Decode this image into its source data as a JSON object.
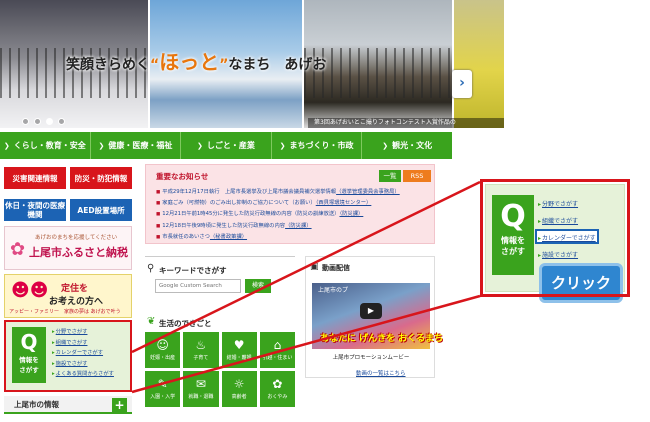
{
  "hero": {
    "slogan_pre": "笑顔きらめく",
    "slogan_q1": "“",
    "slogan_hotto": "ほっと",
    "slogan_q2": "”",
    "slogan_post": "なまち　あげお",
    "caption": "第3回あげおいとこ撮りフォトコンテスト入賞作品の",
    "next": "›",
    "dots": 4,
    "active_dot": 3
  },
  "nav": [
    {
      "label": "くらし・教育・安全",
      "icon": "chevron-icon"
    },
    {
      "label": "健康・医療・福祉",
      "icon": "chevron-icon"
    },
    {
      "label": "しごと・産業",
      "icon": "chevron-icon"
    },
    {
      "label": "まちづくり・市政",
      "icon": "chevron-icon"
    },
    {
      "label": "観光・文化",
      "icon": "chevron-icon"
    }
  ],
  "left": {
    "saigai": "災害関連情報",
    "bohan": "防災・防犯情報",
    "kyujitsu": "休日・夜間の医療機関",
    "aed": "AED設置場所",
    "furusato_t1": "あげおのまちを応援してください",
    "furusato_t2": "上尾市ふるさと納税",
    "teiju_t1": "定住を",
    "teiju_t2": "お考えの方へ",
    "teiju_t3": "アッピー・ファミリー　家族の夢は あげおで叶う",
    "search_label": "情報を\nさがす",
    "search_label_1": "情報を",
    "search_label_2": "さがす",
    "links": [
      "分野でさがす",
      "組織でさがす",
      "カレンダーでさがす",
      "施設でさがす",
      "よくある質問からさがす"
    ],
    "joho": "上尾市の情報",
    "plus": "+"
  },
  "notice": {
    "title": "重要なお知らせ",
    "list_btn": "一覧",
    "rss_btn": "RSS",
    "items": [
      {
        "text": "平成29年12月17日執行　上尾市長選挙及び上尾市議会議員補欠選挙情報",
        "dept": "（選挙管理委員会事務局）"
      },
      {
        "text": "家庭ごみ（可燃物）のごみ出し抑制のご協力について（お願い）",
        "dept": "（西貝塚環境センター）"
      },
      {
        "text": "12月21日午前1時45分に発生した防災行政無線の内容（防災の訓練放送）",
        "dept": "（防災課）"
      },
      {
        "text": "12月18日午後9時頃に発生した防災行政無線の内容",
        "dept": "（防災課）"
      },
      {
        "text": "市長就任のあいさつ",
        "dept": "（秘書政策課）"
      }
    ]
  },
  "keyword": {
    "title": "キーワードでさがす",
    "placeholder": "Google Custom Search",
    "button": "検索"
  },
  "life": {
    "title": "生活のできごと",
    "items": [
      {
        "label": "妊娠・出産",
        "icon": "baby-icon",
        "glyph": "☺"
      },
      {
        "label": "子育て",
        "icon": "bottle-icon",
        "glyph": "♨"
      },
      {
        "label": "結婚・離婚",
        "icon": "couple-icon",
        "glyph": "♥"
      },
      {
        "label": "引越・住まい",
        "icon": "house-icon",
        "glyph": "⌂"
      },
      {
        "label": "入園・入学",
        "icon": "school-icon",
        "glyph": "✎"
      },
      {
        "label": "就職・退職",
        "icon": "shirt-icon",
        "glyph": "✉"
      },
      {
        "label": "高齢者",
        "icon": "elder-icon",
        "glyph": "☼"
      },
      {
        "label": "おくやみ",
        "icon": "flower-icon",
        "glyph": "✿"
      }
    ]
  },
  "video": {
    "title": "動画配信",
    "tag": "上尾市のプ",
    "play": "▶",
    "big": "あなたに げんきを おくるまち",
    "caption": "上尾市プロモーションムービー",
    "link": "動画の一覧はこちら"
  },
  "zoom": {
    "label_1": "情報を",
    "label_2": "さがす",
    "links": [
      "分野でさがす",
      "組織でさがす",
      "カレンダーでさがす",
      "施設でさがす"
    ],
    "click": "クリック"
  },
  "colors": {
    "green": "#3aa31d",
    "red": "#d8151b",
    "blue": "#1c63b4",
    "highlight": "#2f86d0"
  }
}
